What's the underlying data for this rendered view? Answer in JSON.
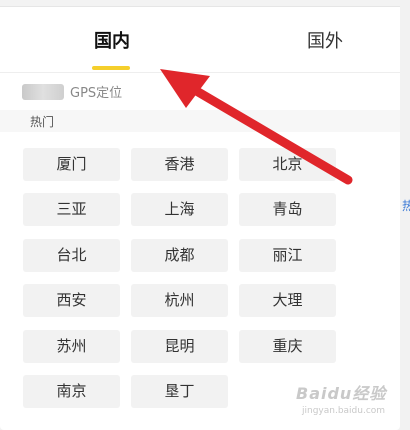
{
  "tabs": {
    "domestic": "国内",
    "overseas": "国外"
  },
  "gps": {
    "label": "GPS定位"
  },
  "hot_section": {
    "title": "热门"
  },
  "cities": [
    "厦门",
    "香港",
    "北京",
    "三亚",
    "上海",
    "青岛",
    "台北",
    "成都",
    "丽江",
    "西安",
    "杭州",
    "大理",
    "苏州",
    "昆明",
    "重庆",
    "南京",
    "垦丁"
  ],
  "edge_text": "热",
  "watermark": {
    "main": "Baidu经验",
    "sub": "jingyan.baidu.com"
  },
  "colors": {
    "accent_underline": "#f5cf2c",
    "arrow": "#e0262b",
    "chip_background": "#f2f2f2"
  },
  "icons": {
    "annotation": "red-arrow-pointer"
  }
}
